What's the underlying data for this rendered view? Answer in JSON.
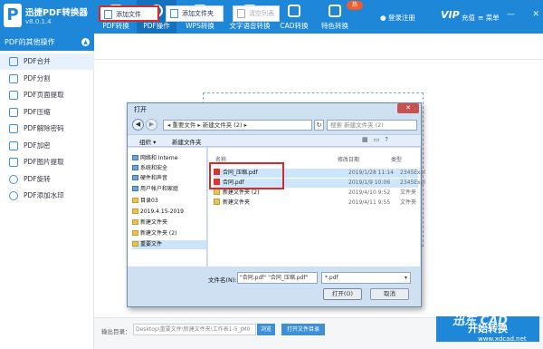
{
  "app": {
    "name": "迅捷PDF转换器",
    "version": "v8.0.1.4",
    "logo": "P"
  },
  "nav": [
    {
      "label": "PDF转换",
      "icon": "convert-icon"
    },
    {
      "label": "PDF操作",
      "icon": "gear-icon"
    },
    {
      "label": "WPS转换",
      "icon": "wps-icon"
    },
    {
      "label": "文字语音转换",
      "icon": "audio-bars-icon"
    },
    {
      "label": "CAD转换",
      "icon": "cad-icon"
    },
    {
      "label": "特色转换",
      "icon": "gift-icon"
    }
  ],
  "header": {
    "badge": "热",
    "login": "登录注册",
    "vip_logo": "VIP",
    "recharge": "充值",
    "menu": "菜单"
  },
  "sidebar": {
    "title": "PDF的其他操作",
    "items": [
      {
        "label": "PDF合并"
      },
      {
        "label": "PDF分割"
      },
      {
        "label": "PDF页面提取"
      },
      {
        "label": "PDF压缩"
      },
      {
        "label": "PDF解除密码"
      },
      {
        "label": "PDF加密"
      },
      {
        "label": "PDF图片提取"
      },
      {
        "label": "PDF旋转"
      },
      {
        "label": "PDF添加水印"
      }
    ]
  },
  "toolbar": {
    "add_file": "添加文件",
    "add_folder": "添加文件夹",
    "clear_list": "清空列表"
  },
  "dialog": {
    "title": "打开",
    "close": "✕",
    "address": "◂ 重要文件 ▸ 新建文件夹 (2) ▸",
    "search_placeholder": "搜索 新建文件夹 (2)",
    "organize": "组织 ▾",
    "new_folder": "新建文件夹",
    "nav": [
      "网络和 Interne",
      "系统和安全",
      "硬件和声音",
      "用户帐户和家庭",
      "目录03",
      "2019.4.15-2019",
      "新建文件夹",
      "新建文件夹 (2)",
      "重要文件"
    ],
    "columns": {
      "name": "名称",
      "date": "修改日期",
      "type": "类型"
    },
    "files": [
      {
        "name": "合同_压缩.pdf",
        "date": "2019/1/28 11:14",
        "type": "2345Expl",
        "kind": "pdf"
      },
      {
        "name": "合同.pdf",
        "date": "2019/1/9 10:06",
        "type": "2345Expl",
        "kind": "pdf"
      },
      {
        "name": "新建文件夹 (2)",
        "date": "2019/4/10 9:52",
        "type": "文件夹",
        "kind": "dir"
      },
      {
        "name": "新建文件夹",
        "date": "2019/4/11 9:55",
        "type": "文件夹",
        "kind": "dir"
      }
    ],
    "filename_label": "文件名(N):",
    "filename_value": "\"合同.pdf\" \"合同_压缩.pdf\"",
    "filetype": "*.pdf",
    "open": "打开(O)",
    "cancel": "取消"
  },
  "bottom": {
    "output_label": "输出目录：",
    "output_path": "Desktop\\重要文件\\新建文件夹\\工作表1-5_JM0",
    "browse": "浏览",
    "open_folder": "打开文件目录",
    "convert": "开始转换"
  },
  "watermark": {
    "text": "迅东 CAD",
    "url": "www.xdcad.net"
  },
  "colors": {
    "primary": "#1f87d8",
    "highlight": "#d62b2b"
  }
}
